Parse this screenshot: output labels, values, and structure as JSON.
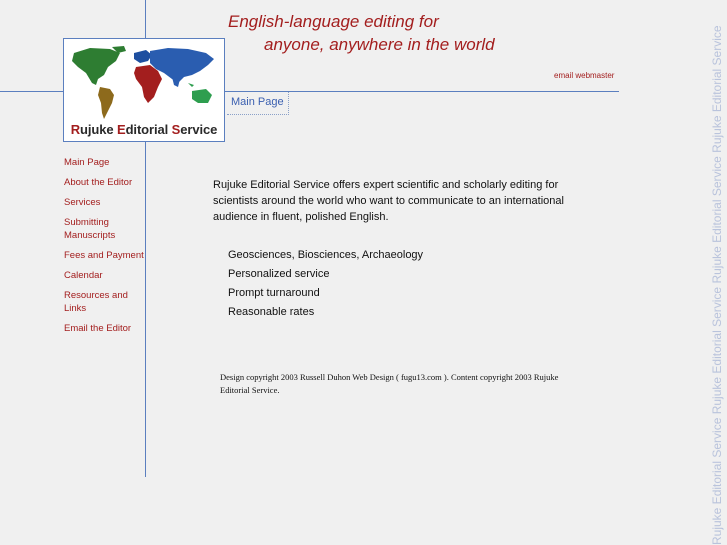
{
  "tagline": {
    "line1": "English-language editing for",
    "line2": "anyone, anywhere in the world"
  },
  "email_link": "email webmaster",
  "logo": {
    "name_r": "R",
    "name_rest1": "ujuke ",
    "name_e": "E",
    "name_rest2": "ditorial ",
    "name_s": "S",
    "name_rest3": "ervice"
  },
  "main_tab": "Main Page",
  "nav": {
    "items": [
      {
        "label": "Main Page"
      },
      {
        "label": "About the Editor"
      },
      {
        "label": "Services"
      },
      {
        "label": "Submitting Manuscripts"
      },
      {
        "label": "Fees and Payment"
      },
      {
        "label": "Calendar"
      },
      {
        "label": "Resources and Links"
      },
      {
        "label": "Email the Editor"
      }
    ]
  },
  "content": {
    "intro": "Rujuke Editorial Service offers expert scientific and scholarly editing for scientists around the world who want to communicate to an international audience in fluent, polished English.",
    "features": [
      "Geosciences, Biosciences, Archaeology",
      "Personalized service",
      "Prompt turnaround",
      "Reasonable rates"
    ],
    "copyright": "Design copyright 2003 Russell Duhon Web Design ( fugu13.com ). Content copyright 2003 Rujuke Editorial Service."
  },
  "watermark": "Rujuke Editorial Service  Rujuke Editorial Service  Rujuke Editorial Service  Rujuke Editorial Service",
  "colors": {
    "accent_red": "#a31e1e",
    "line_blue": "#5b7fbf",
    "link_blue": "#3a5fb0",
    "background": "#f0f0f0"
  }
}
